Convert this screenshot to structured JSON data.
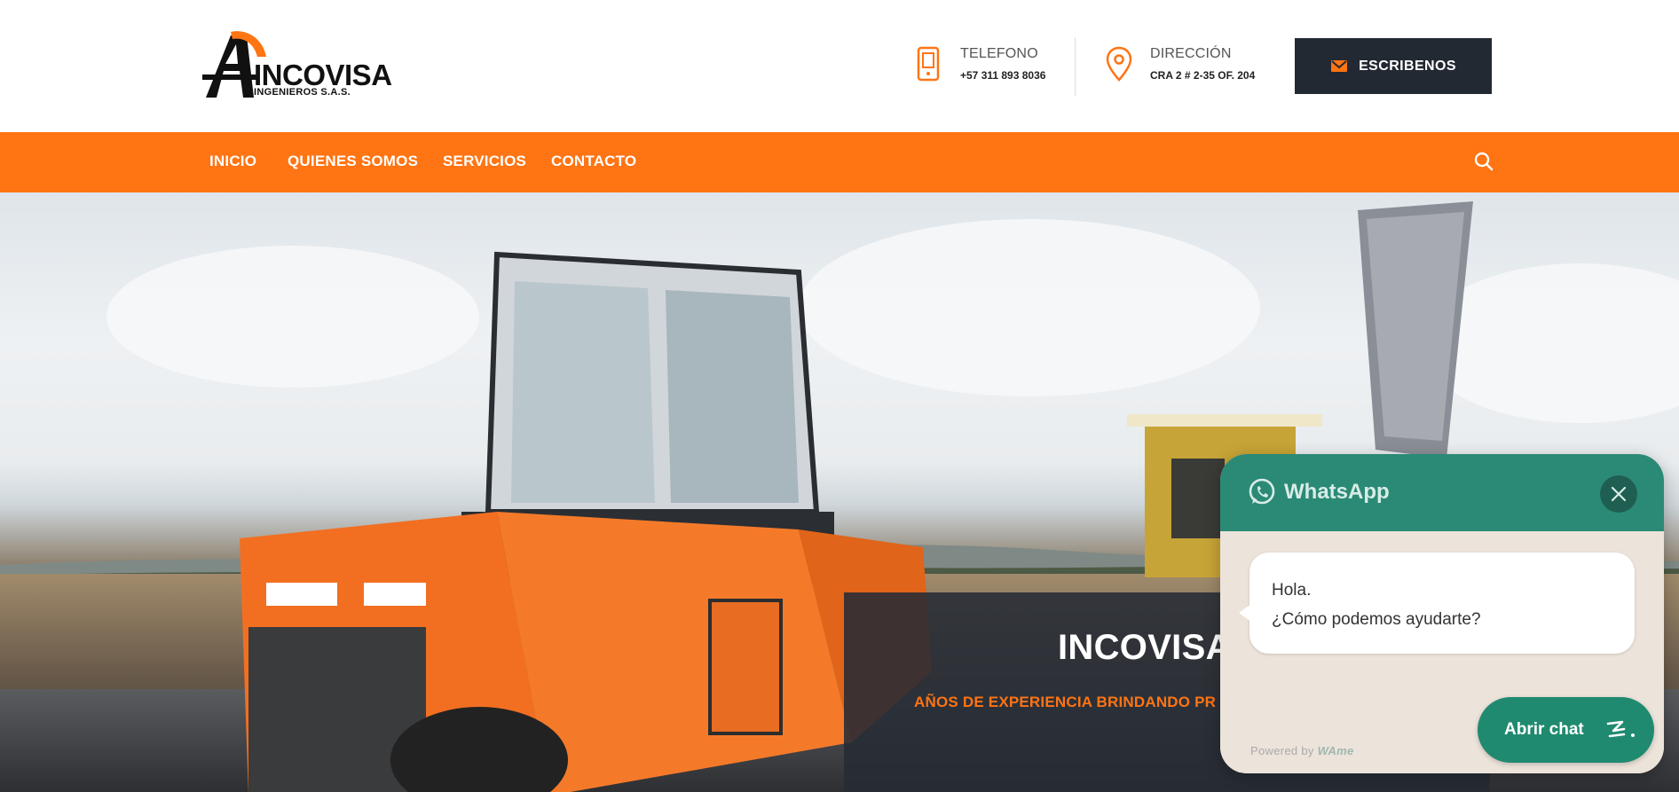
{
  "brand": {
    "name": "INCOVISA",
    "sub": "INGENIEROS S.A.S.",
    "colors": {
      "accent": "#ff7413",
      "dark": "#232933",
      "whatsapp": "#2b8a76"
    }
  },
  "header": {
    "phone": {
      "label": "TELEFONO",
      "value": "+57 311 893 8036",
      "icon": "phone-icon"
    },
    "address": {
      "label": "DIRECCIÓN",
      "value": "CRA 2 # 2-35 OF. 204",
      "icon": "map-pin-icon"
    },
    "cta": {
      "label": "ESCRIBENOS",
      "icon": "envelope-icon"
    }
  },
  "nav": {
    "items": [
      {
        "label": "INICIO"
      },
      {
        "label": "QUIENES SOMOS"
      },
      {
        "label": "SERVICIOS"
      },
      {
        "label": "CONTACTO"
      }
    ],
    "search_icon": "search-icon"
  },
  "hero": {
    "title": "INCOVISA",
    "subtitle": "AÑOS DE EXPERIENCIA BRINDANDO PR"
  },
  "whatsapp": {
    "title": "WhatsApp",
    "greeting_line1": "Hola.",
    "greeting_line2": "¿Cómo podemos ayudarte?",
    "open_label": "Abrir chat",
    "powered_prefix": "Powered by",
    "powered_brand": "WAme"
  }
}
